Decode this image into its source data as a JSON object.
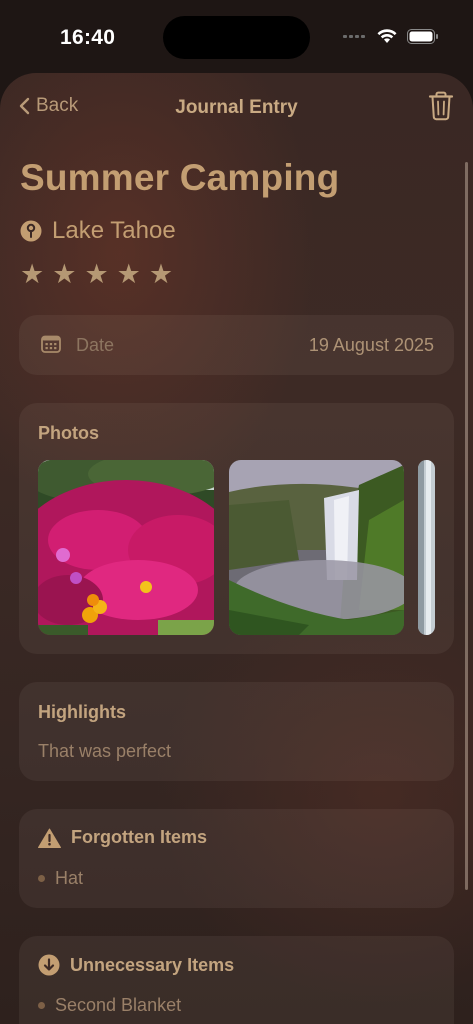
{
  "status_bar": {
    "time": "16:40"
  },
  "nav": {
    "back_label": "Back",
    "title": "Journal Entry"
  },
  "entry": {
    "title": "Summer Camping",
    "location": "Lake Tahoe",
    "rating": 5,
    "rating_max": 5
  },
  "date_row": {
    "label": "Date",
    "value": "19 August 2025"
  },
  "photos": {
    "heading": "Photos",
    "items": [
      "flowers-photo",
      "waterfall-photo",
      "partial-photo"
    ]
  },
  "highlights": {
    "heading": "Highlights",
    "text": "That was perfect"
  },
  "forgotten": {
    "heading": "Forgotten Items",
    "items": [
      "Hat"
    ]
  },
  "unnecessary": {
    "heading": "Unnecessary Items",
    "items": [
      "Second Blanket"
    ]
  },
  "colors": {
    "accent": "#c39e72",
    "background": "#3a2824",
    "card": "#4a3630"
  }
}
